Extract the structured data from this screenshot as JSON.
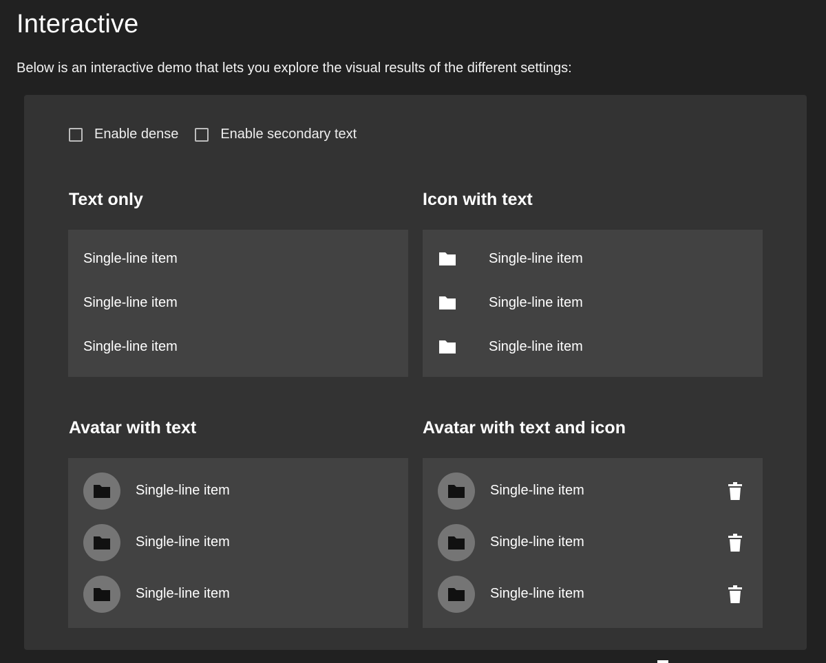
{
  "page": {
    "title": "Interactive",
    "intro": "Below is an interactive demo that lets you explore the visual results of the different settings:"
  },
  "options": {
    "dense_label": "Enable dense",
    "dense_checked": false,
    "secondary_label": "Enable secondary text",
    "secondary_checked": false
  },
  "sections": {
    "text_only": {
      "title": "Text only",
      "items": [
        "Single-line item",
        "Single-line item",
        "Single-line item"
      ]
    },
    "icon_with_text": {
      "title": "Icon with text",
      "icon": "folder-icon",
      "items": [
        "Single-line item",
        "Single-line item",
        "Single-line item"
      ]
    },
    "avatar_with_text": {
      "title": "Avatar with text",
      "avatar_icon": "folder-icon",
      "items": [
        "Single-line item",
        "Single-line item",
        "Single-line item"
      ]
    },
    "avatar_with_text_and_icon": {
      "title": "Avatar with text and icon",
      "avatar_icon": "folder-icon",
      "action_icon": "delete-icon",
      "items": [
        "Single-line item",
        "Single-line item",
        "Single-line item"
      ]
    }
  },
  "colors": {
    "background": "#212121",
    "panel": "#333333",
    "list_surface": "#424242",
    "avatar": "#757575"
  }
}
